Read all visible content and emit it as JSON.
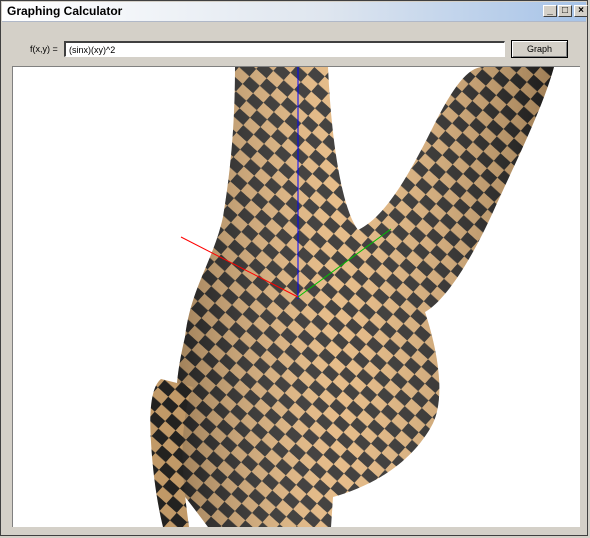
{
  "window": {
    "title": "Graphing Calculator",
    "controls": {
      "minimize": "_",
      "maximize": "□",
      "close": "×"
    }
  },
  "toolbar": {
    "function_label": "f(x,y) =",
    "function_value": "(sinx)(xy)^2",
    "graph_button": "Graph"
  },
  "plot": {
    "surface_colors": {
      "light": "#e3b47a",
      "dark": "#2a2826"
    },
    "axis_colors": {
      "x": "#ff0000",
      "y": "#00c000",
      "z": "#0000ff"
    }
  }
}
